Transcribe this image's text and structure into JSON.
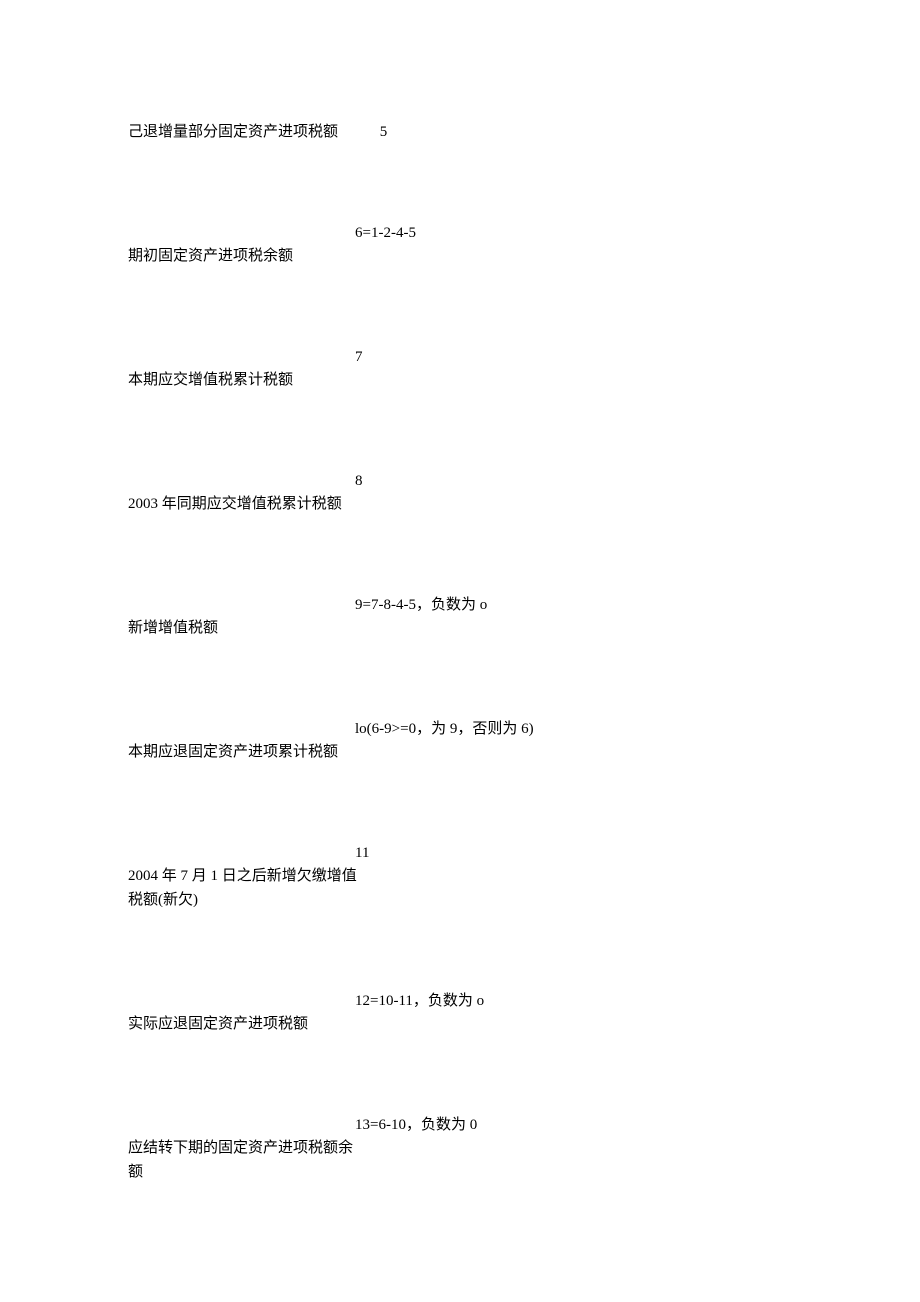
{
  "rows": [
    {
      "label": "己退增量部分固定资产进项税额",
      "value": "5"
    },
    {
      "label": "期初固定资产进项税余额",
      "value": "6=1-2-4-5"
    },
    {
      "label": "本期应交增值税累计税额",
      "value": "7"
    },
    {
      "label": "2003 年同期应交增值税累计税额",
      "value": "8"
    },
    {
      "label": "新增增值税额",
      "value": "9=7-8-4-5，负数为 o"
    },
    {
      "label": "本期应退固定资产进项累计税额",
      "value": "lo(6-9>=0，为 9，否则为 6)"
    },
    {
      "label": "2004 年 7 月 1 日之后新增欠缴增值税额(新欠)",
      "value": "11"
    },
    {
      "label": "实际应退固定资产进项税额",
      "value": "12=10-11，负数为 o"
    },
    {
      "label": "应结转下期的固定资产进项税额余额",
      "value": "13=6-10，负数为 0"
    }
  ]
}
